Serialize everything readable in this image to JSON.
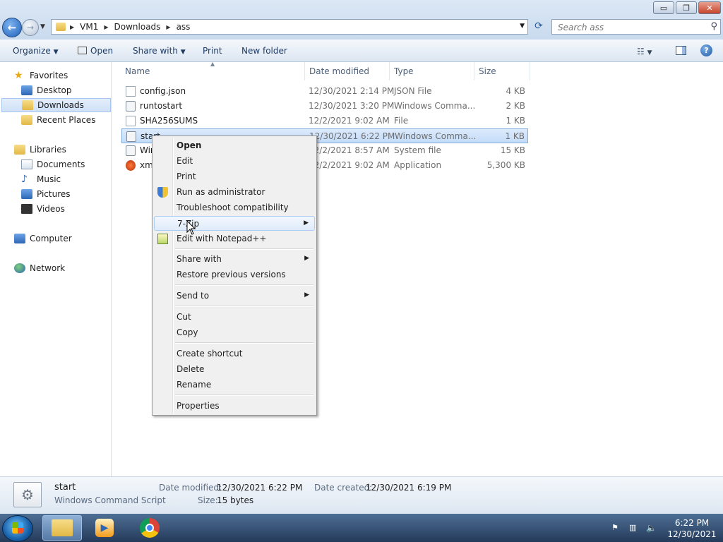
{
  "window": {
    "minimize_glyph": "▭",
    "maximize_glyph": "❐",
    "close_glyph": "✕"
  },
  "address": {
    "segments": [
      "VM1",
      "Downloads",
      "ass"
    ]
  },
  "search": {
    "placeholder": "Search ass"
  },
  "toolbar": {
    "organize": "Organize",
    "open": "Open",
    "share_with": "Share with",
    "print": "Print",
    "new_folder": "New folder"
  },
  "nav": {
    "favorites": "Favorites",
    "desktop": "Desktop",
    "downloads": "Downloads",
    "recent_places": "Recent Places",
    "libraries": "Libraries",
    "documents": "Documents",
    "music": "Music",
    "pictures": "Pictures",
    "videos": "Videos",
    "computer": "Computer",
    "network": "Network"
  },
  "columns": {
    "name": "Name",
    "date_modified": "Date modified",
    "type": "Type",
    "size": "Size"
  },
  "files": [
    {
      "name": "config.json",
      "date": "12/30/2021 2:14 PM",
      "type": "JSON File",
      "size": "4 KB"
    },
    {
      "name": "runtostart",
      "date": "12/30/2021 3:20 PM",
      "type": "Windows Comma...",
      "size": "2 KB"
    },
    {
      "name": "SHA256SUMS",
      "date": "12/2/2021 9:02 AM",
      "type": "File",
      "size": "1 KB"
    },
    {
      "name": "start",
      "date": "12/30/2021 6:22 PM",
      "type": "Windows Comma...",
      "size": "1 KB"
    },
    {
      "name": "Wir",
      "date": "12/2/2021 8:57 AM",
      "type": "System file",
      "size": "15 KB"
    },
    {
      "name": "xm",
      "date": "12/2/2021 9:02 AM",
      "type": "Application",
      "size": "5,300 KB"
    }
  ],
  "context_menu": {
    "open": "Open",
    "edit": "Edit",
    "print": "Print",
    "run_as_admin": "Run as administrator",
    "troubleshoot": "Troubleshoot compatibility",
    "seven_zip": "7-Zip",
    "edit_notepadpp": "Edit with Notepad++",
    "share_with": "Share with",
    "restore_versions": "Restore previous versions",
    "send_to": "Send to",
    "cut": "Cut",
    "copy": "Copy",
    "create_shortcut": "Create shortcut",
    "delete": "Delete",
    "rename": "Rename",
    "properties": "Properties"
  },
  "details": {
    "name": "start",
    "type": "Windows Command Script",
    "date_modified_label": "Date modified:",
    "date_modified": "12/30/2021 6:22 PM",
    "date_created_label": "Date created:",
    "date_created": "12/30/2021 6:19 PM",
    "size_label": "Size:",
    "size": "15 bytes"
  },
  "taskbar": {
    "time": "6:22 PM",
    "date": "12/30/2021"
  },
  "colors": {
    "accent": "#2b5d9c",
    "selection": "#cfe1f7"
  }
}
